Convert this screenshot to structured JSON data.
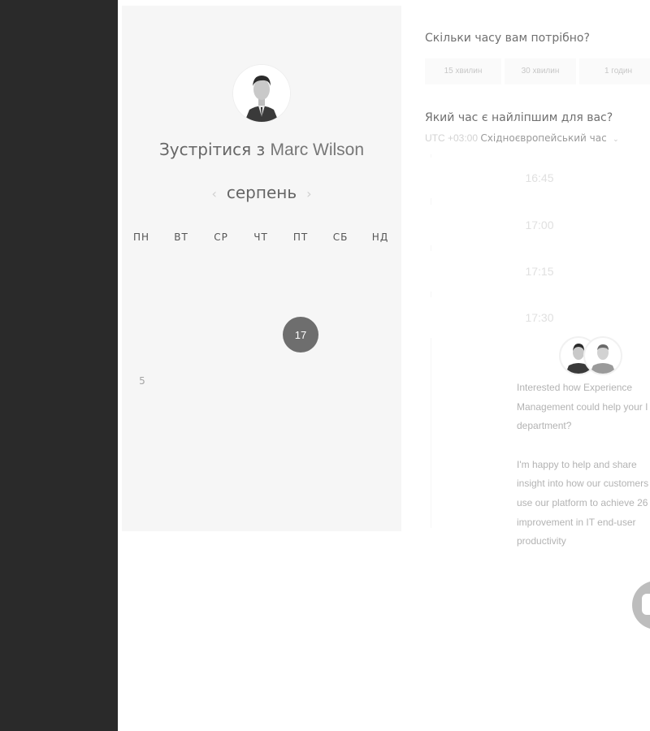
{
  "calendar": {
    "title_prefix": "Зустрітися з ",
    "host_name": "Marc Wilson",
    "month": "серпень",
    "prev_arrow": "‹",
    "next_arrow": "›",
    "weekdays": [
      "ПН",
      "ВТ",
      "СР",
      "ЧТ",
      "ПТ",
      "СБ",
      "НД"
    ],
    "selected_day": "17",
    "visible_day": "5"
  },
  "booking": {
    "duration_question": "Скільки часу вам потрібно?",
    "durations": [
      "15 хвилин",
      "30 хвилин",
      "1 годин"
    ],
    "time_question": "Який час є найліпшим для вас?",
    "timezone_offset": "UTC +03:00",
    "timezone_name": "Східноєвропейський час",
    "timezone_caret": "⌄",
    "slots": [
      "16:45",
      "17:00",
      "17:15",
      "17:30"
    ]
  },
  "chat": {
    "lines": [
      "Interested how Experience",
      "Management could help your I",
      "department?",
      "",
      "I'm happy to help and share",
      "insight into how our customers",
      "use our platform to achieve 26",
      "improvement in IT end-user",
      "productivity"
    ]
  }
}
